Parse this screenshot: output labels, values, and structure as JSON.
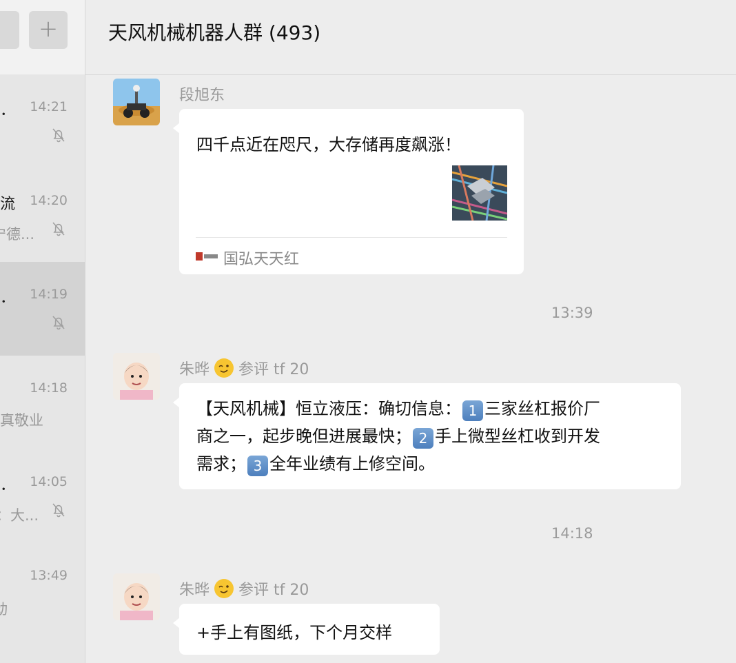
{
  "sidebar": {
    "add_label": "+",
    "conversations": [
      {
        "name": "．",
        "time": "14:21",
        "preview": "",
        "muted": true,
        "active": false
      },
      {
        "name": "流",
        "time": "14:20",
        "preview": "宁德...",
        "muted": true,
        "active": false
      },
      {
        "name": "．",
        "time": "14:19",
        "preview": "",
        "muted": true,
        "active": true
      },
      {
        "name": "",
        "time": "14:18",
        "preview": "真敬业",
        "muted": false,
        "active": false
      },
      {
        "name": "．",
        "time": "14:05",
        "preview": "：大...",
        "muted": true,
        "active": false
      },
      {
        "name": "",
        "time": "13:49",
        "preview": "动",
        "muted": false,
        "active": false
      }
    ]
  },
  "header": {
    "title": "天风机械机器人群 (493)"
  },
  "messages": [
    {
      "sender": "段旭东",
      "text": "四千点近在咫尺，大存储再度飙涨！",
      "source": "国弘天天红"
    },
    {
      "timestamp": "13:39"
    },
    {
      "sender_name": "朱晔",
      "sender_suffix": "参评 tf 20",
      "line1_a": "【天风机械】恒立液压：确切信息：",
      "badge1": "1",
      "line1_b": "三家丝杠报价厂",
      "line2_a": "商之一，起步晚但进展最快；",
      "badge2": "2",
      "line2_b": "手上微型丝杠收到开发",
      "line3_a": "需求；",
      "badge3": "3",
      "line3_b": "全年业绩有上修空间。"
    },
    {
      "timestamp": "14:18"
    },
    {
      "sender_name": "朱晔",
      "sender_suffix": "参评 tf 20",
      "text": "+手上有图纸，下个月交样"
    }
  ],
  "colors": {
    "background": "#ededed",
    "bubble": "#ffffff",
    "sidebar_active": "#d3d3d3"
  }
}
